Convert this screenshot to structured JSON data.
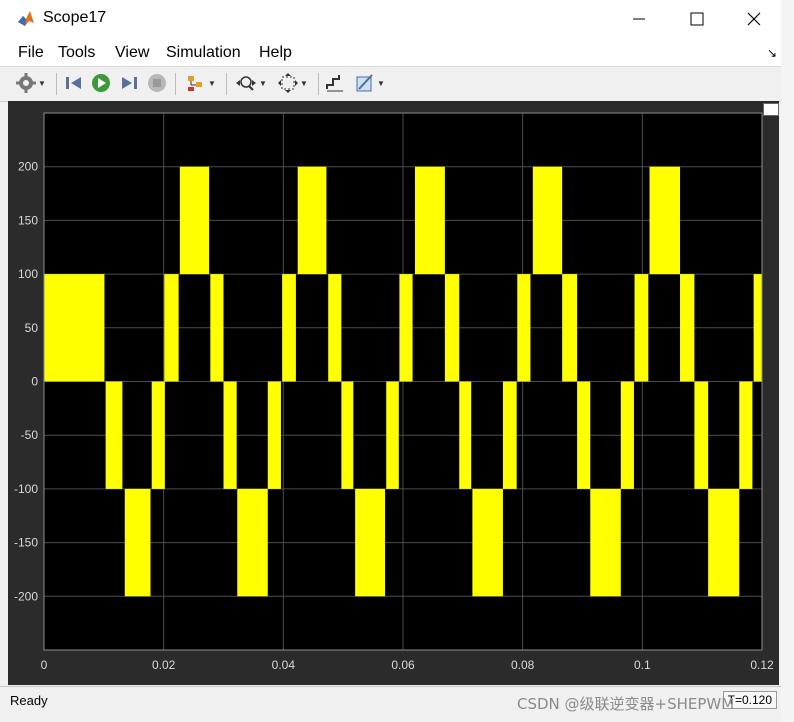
{
  "window": {
    "title": "Scope17",
    "controls": [
      "minimize",
      "maximize",
      "close"
    ]
  },
  "menubar": {
    "items": [
      "File",
      "Tools",
      "View",
      "Simulation",
      "Help"
    ]
  },
  "toolbar": {
    "icons": [
      "gear-icon",
      "step-back-icon",
      "run-icon",
      "step-forward-icon",
      "stop-icon",
      "signal-hierarchy-icon",
      "zoom-icon",
      "fit-to-view-icon",
      "cursor-measure-icon",
      "style-icon"
    ]
  },
  "chart_data": {
    "type": "line",
    "title": "",
    "xlabel": "",
    "ylabel": "",
    "xlim": [
      0,
      0.12
    ],
    "ylim": [
      -250,
      250
    ],
    "xticks": [
      0,
      0.02,
      0.04,
      0.06,
      0.08,
      0.1,
      0.12
    ],
    "xtick_labels": [
      "0",
      "0.02",
      "0.04",
      "0.06",
      "0.08",
      "0.1",
      "0.12"
    ],
    "yticks": [
      -200,
      -150,
      -100,
      -50,
      0,
      50,
      100,
      150,
      200
    ],
    "ytick_labels": [
      "-200",
      "-150",
      "-100",
      "-50",
      "0",
      "50",
      "100",
      "150",
      "200"
    ],
    "grid": true,
    "background": "#000000",
    "line_color": "#ffff00",
    "series": [
      {
        "filled_bands": [
          {
            "x0": 0.0,
            "x1": 0.0101,
            "y0": 0,
            "y1": 100
          },
          {
            "x0": 0.0103,
            "x1": 0.0131,
            "y0": -100,
            "y1": 0
          },
          {
            "x0": 0.0135,
            "x1": 0.0178,
            "y0": -200,
            "y1": -100
          },
          {
            "x0": 0.018,
            "x1": 0.0202,
            "y0": -100,
            "y1": 0
          },
          {
            "x0": 0.0201,
            "x1": 0.0225,
            "y0": 0,
            "y1": 100
          },
          {
            "x0": 0.0227,
            "x1": 0.0276,
            "y0": 100,
            "y1": 200
          },
          {
            "x0": 0.0278,
            "x1": 0.03,
            "y0": 0,
            "y1": 100
          },
          {
            "x0": 0.03,
            "x1": 0.0322,
            "y0": -100,
            "y1": 0
          },
          {
            "x0": 0.0323,
            "x1": 0.0374,
            "y0": -200,
            "y1": -100
          },
          {
            "x0": 0.0374,
            "x1": 0.0396,
            "y0": -100,
            "y1": 0
          },
          {
            "x0": 0.0398,
            "x1": 0.0421,
            "y0": 0,
            "y1": 100
          },
          {
            "x0": 0.0424,
            "x1": 0.0472,
            "y0": 100,
            "y1": 200
          },
          {
            "x0": 0.0475,
            "x1": 0.0497,
            "y0": 0,
            "y1": 100
          },
          {
            "x0": 0.0497,
            "x1": 0.0517,
            "y0": -100,
            "y1": 0
          },
          {
            "x0": 0.052,
            "x1": 0.057,
            "y0": -200,
            "y1": -100
          },
          {
            "x0": 0.0572,
            "x1": 0.0593,
            "y0": -100,
            "y1": 0
          },
          {
            "x0": 0.0594,
            "x1": 0.0616,
            "y0": 0,
            "y1": 100
          },
          {
            "x0": 0.062,
            "x1": 0.067,
            "y0": 100,
            "y1": 200
          },
          {
            "x0": 0.067,
            "x1": 0.0694,
            "y0": 0,
            "y1": 100
          },
          {
            "x0": 0.0694,
            "x1": 0.0714,
            "y0": -100,
            "y1": 0
          },
          {
            "x0": 0.0716,
            "x1": 0.0767,
            "y0": -200,
            "y1": -100
          },
          {
            "x0": 0.0767,
            "x1": 0.079,
            "y0": -100,
            "y1": 0
          },
          {
            "x0": 0.0791,
            "x1": 0.0813,
            "y0": 0,
            "y1": 100
          },
          {
            "x0": 0.0817,
            "x1": 0.0866,
            "y0": 100,
            "y1": 200
          },
          {
            "x0": 0.0866,
            "x1": 0.0891,
            "y0": 0,
            "y1": 100
          },
          {
            "x0": 0.0891,
            "x1": 0.0913,
            "y0": -100,
            "y1": 0
          },
          {
            "x0": 0.0913,
            "x1": 0.0964,
            "y0": -200,
            "y1": -100
          },
          {
            "x0": 0.0964,
            "x1": 0.0986,
            "y0": -100,
            "y1": 0
          },
          {
            "x0": 0.0987,
            "x1": 0.101,
            "y0": 0,
            "y1": 100
          },
          {
            "x0": 0.1012,
            "x1": 0.1063,
            "y0": 100,
            "y1": 200
          },
          {
            "x0": 0.1063,
            "x1": 0.1087,
            "y0": 0,
            "y1": 100
          },
          {
            "x0": 0.1087,
            "x1": 0.111,
            "y0": -100,
            "y1": 0
          },
          {
            "x0": 0.111,
            "x1": 0.1162,
            "y0": -200,
            "y1": -100
          },
          {
            "x0": 0.1162,
            "x1": 0.1184,
            "y0": -100,
            "y1": 0
          },
          {
            "x0": 0.1186,
            "x1": 0.12,
            "y0": 0,
            "y1": 100
          }
        ]
      }
    ]
  },
  "statusbar": {
    "status": "Ready",
    "time": "T=0.120"
  },
  "watermark": "CSDN @级联逆变器+SHEPWM"
}
